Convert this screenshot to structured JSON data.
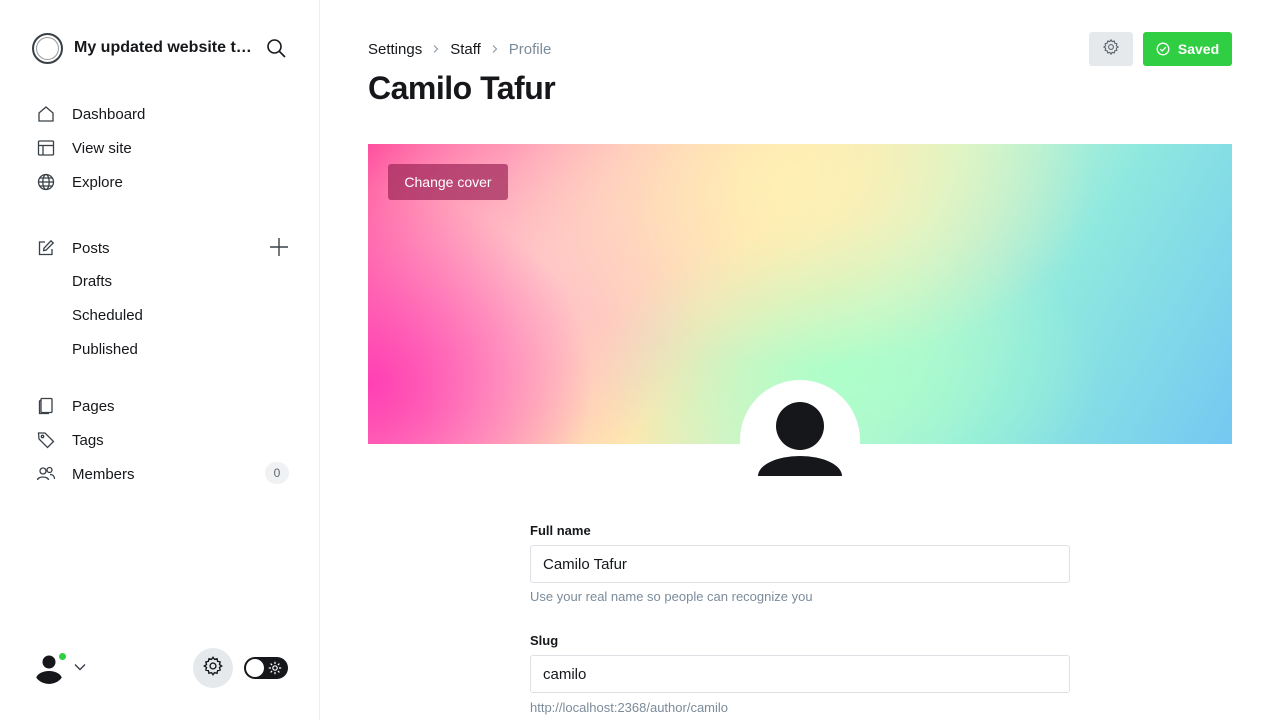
{
  "sidebar": {
    "site_title": "My updated website title",
    "nav": {
      "dashboard": "Dashboard",
      "view_site": "View site",
      "explore": "Explore",
      "posts": "Posts",
      "drafts": "Drafts",
      "scheduled": "Scheduled",
      "published": "Published",
      "pages": "Pages",
      "tags": "Tags",
      "members": "Members",
      "members_count": "0"
    }
  },
  "header": {
    "breadcrumb": [
      "Settings",
      "Staff",
      "Profile"
    ],
    "title": "Camilo Tafur",
    "saved_label": "Saved"
  },
  "cover": {
    "change_cover_label": "Change cover"
  },
  "form": {
    "full_name": {
      "label": "Full name",
      "value": "Camilo Tafur",
      "hint": "Use your real name so people can recognize you"
    },
    "slug": {
      "label": "Slug",
      "value": "camilo",
      "hint": "http://localhost:2368/author/camilo"
    }
  },
  "colors": {
    "accent_green": "#30cf43",
    "text": "#15171a",
    "muted": "#7c8b9a"
  },
  "icons": [
    "search-icon",
    "home-icon",
    "layout-icon",
    "globe-icon",
    "edit-icon",
    "plus-icon",
    "page-icon",
    "tag-icon",
    "members-icon",
    "gear-icon",
    "chevron-down-icon",
    "sun-icon",
    "check-circle-icon",
    "chevron-right-icon"
  ]
}
